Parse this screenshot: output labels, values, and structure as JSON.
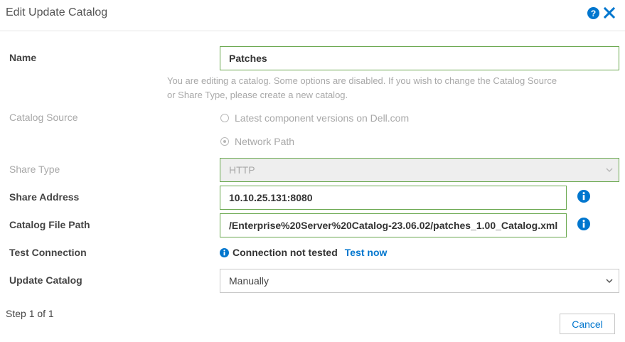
{
  "dialog": {
    "title": "Edit Update Catalog"
  },
  "colors": {
    "accent": "#0076ce",
    "valid_border": "#6aa84f",
    "disabled_text": "#a8a8a8"
  },
  "form": {
    "name": {
      "label": "Name",
      "value": "Patches"
    },
    "hint": "You are editing a catalog. Some options are disabled.   If you wish to change the Catalog Source or Share Type, please create a new catalog.",
    "catalog_source": {
      "label": "Catalog Source",
      "options": [
        {
          "label": "Latest component versions on Dell.com",
          "selected": false
        },
        {
          "label": "Network Path",
          "selected": true
        }
      ]
    },
    "share_type": {
      "label": "Share Type",
      "value": "HTTP"
    },
    "share_address": {
      "label": "Share Address",
      "value": "10.10.25.131:8080"
    },
    "catalog_file_path": {
      "label": "Catalog File Path",
      "value": "/Enterprise%20Server%20Catalog-23.06.02/patches_1.00_Catalog.xml"
    },
    "test_connection": {
      "label": "Test Connection",
      "status": "Connection not tested",
      "action": "Test now"
    },
    "update_catalog": {
      "label": "Update Catalog",
      "value": "Manually"
    }
  },
  "footer": {
    "step": "Step 1 of 1",
    "cancel_label": "Cancel"
  }
}
